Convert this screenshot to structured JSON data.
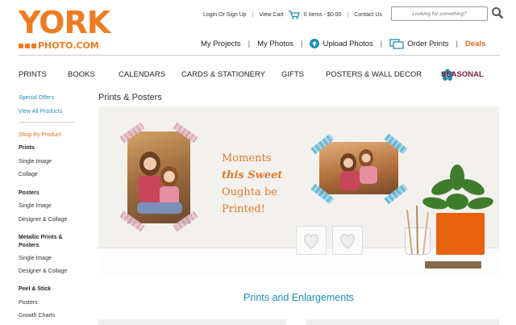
{
  "logo": {
    "line1": "YORK",
    "line2": "PHOTO.COM"
  },
  "util": {
    "login": "Login Or Sign Up",
    "view_cart": "View Cart",
    "cart_count": "0 Items - $0.00",
    "contact": "Contact Us",
    "search_placeholder": "Looking for something?"
  },
  "account_nav": {
    "my_projects": "My Projects",
    "my_photos": "My Photos",
    "upload_photos": "Upload Photos",
    "order_prints": "Order Prints",
    "deals": "Deals"
  },
  "main_nav": [
    "PRINTS",
    "BOOKS",
    "CALENDARS",
    "CARDS & STATIONERY",
    "GIFTS",
    "POSTERS & WALL DECOR",
    "SEASONAL"
  ],
  "sidebar": {
    "special_offers": "Special Offers",
    "view_all": "View All Products",
    "shop_by": "Shop By Product",
    "prints": "Prints",
    "prints_single": "Single Image",
    "prints_collage": "Collage",
    "posters": "Posters",
    "posters_single": "Single Image",
    "posters_designer": "Designer & Collage",
    "metallic_1": "Metallic Prints &",
    "metallic_2": "Posters",
    "metallic_single": "Single Image",
    "metallic_designer": "Designer & Collage",
    "peel": "Peel & Stick",
    "peel_posters": "Posters",
    "peel_growth": "Growth Charts"
  },
  "page_title": "Prints & Posters",
  "hero": {
    "line1": "Moments",
    "line2": "this Sweet",
    "line3": "Oughta be",
    "line4": "Printed!"
  },
  "section_title": "Prints and Enlargements",
  "colors": {
    "brand_orange": "#ef7c22",
    "link_blue": "#1e8fb8",
    "seasonal_maroon": "#7b1f3c"
  }
}
